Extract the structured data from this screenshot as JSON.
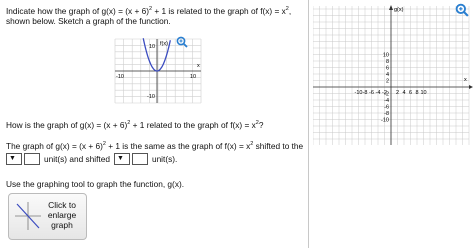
{
  "prompt": {
    "line1_a": "Indicate how the graph of g(x) = (x + 6)",
    "line1_exp": "2",
    "line1_b": " + 1 is related to the graph of f(x) = x",
    "line1_exp2": "2",
    "line1_c": ",",
    "line2": "shown below. Sketch a graph of the function."
  },
  "small_graph": {
    "curve_label": "f(x)",
    "x_axis_label": "x",
    "ticks": {
      "y_top": "10",
      "y_bottom": "-10",
      "x_left": "-10",
      "x_right": "10"
    }
  },
  "question": {
    "text_a": "How is the graph of g(x) = (x + 6)",
    "exp": "2",
    "text_b": " + 1 related to the graph of f(x) = x",
    "exp2": "2",
    "text_c": "?"
  },
  "answer": {
    "line_a": "The graph of g(x) = (x + 6)",
    "exp": "2",
    "line_b": " + 1 is the same as the graph of f(x) = x",
    "exp2": "2",
    "line_c": " shifted to the",
    "units_label_1": "unit(s) and shifted",
    "units_label_2": "unit(s)."
  },
  "instruction": "Use the graphing tool to graph the function, g(x).",
  "enlarge_button": {
    "line1": "Click to",
    "line2": "enlarge",
    "line3": "graph"
  },
  "big_graph": {
    "axis_label_y": "g(x)",
    "axis_label_x": "x",
    "y_ticks": [
      "10",
      "8",
      "6",
      "4",
      "2",
      "-2",
      "-4",
      "-6",
      "-8",
      "-10"
    ],
    "x_ticks": [
      "-10",
      "-8",
      "-6",
      "-4",
      "-2",
      "2",
      "4",
      "6",
      "8",
      "10"
    ]
  },
  "colors": {
    "curve": "#3b4cc0",
    "zoom": "#2a7fd0",
    "grid": "#c9c9c9"
  }
}
